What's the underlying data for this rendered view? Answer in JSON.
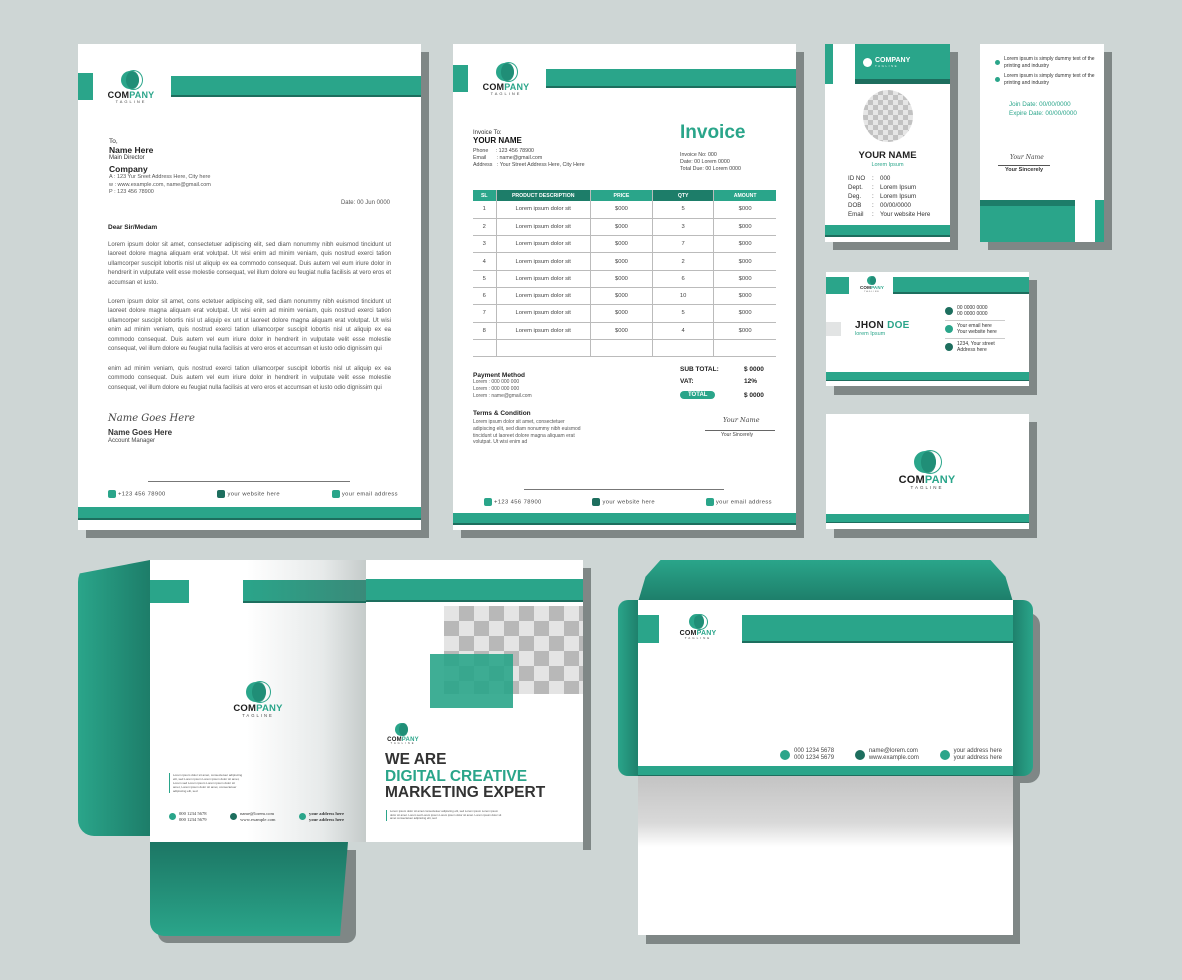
{
  "brand": {
    "word_a": "COM",
    "word_b": "PANY",
    "tagline": "TAGLINE",
    "accent": "#2aa58a",
    "accent_dark": "#1d7d69"
  },
  "letterhead": {
    "to": "To,",
    "name": "Name Here",
    "role": "Main Director",
    "company": "Company",
    "address": "A  : 123 Yur Sreet Address Here, City here",
    "web": "w  : www.example.com, name@gmail.com",
    "phone": "P  : 123 456 78900",
    "date": "Date: 00 Jun 0000",
    "greeting": "Dear Sir/Medam",
    "para1": "Lorem ipsum dolor sit amet, consectetuer adipiscing elit, sed diam nonummy nibh euismod tincidunt ut laoreet dolore magna aliquam erat volutpat. Ut wisi enim ad minim veniam, quis nostrud exerci tation ullamcorper suscipit lobortis nisl ut aliquip ex ea commodo consequat. Duis autem vel eum iriure dolor in hendrerit in vulputate velit esse molestie consequat, vel illum dolore eu feugiat nulla facilisis at vero eros et accumsan et iusto.",
    "para2": "Lorem ipsum dolor sit amet, cons ectetuer adipiscing elit, sed diam nonummy nibh euismod tincidunt ut laoreet dolore magna aliquam erat volutpat. Ut wisi enim ad minim veniam, quis nostrud exerci tation ullamcorper suscipit lobortis nisl ut aliquip ex unt ut laoreet dolore magna aliquam erat volutpat. Ut wisi enim ad minim veniam, quis nostrud exerci tation ullamcorper suscipit lobortis nisl ut aliquip ex ea commodo consequat. Duis autem vel eum iriure dolor in hendrerit in vulputate velit esse molestie consequat, vel illum dolore eu feugiat nulla facilisis at vero eros et accumsan et iusto odio dignissim qui",
    "para3": "enim ad minim veniam, quis nostrud exerci tation ullamcorper suscipit lobortis nisl ut aliquip ex ea commodo consequat. Duis autem vel eum iriure dolor in hendrerit in vulputate velit esse molestie consequat, vel illum dolore eu feugiat nulla facilisis at vero eros et accumsan et iusto odio dignissim qui",
    "signature": "Name Goes Here",
    "signer": "Name Goes Here",
    "signer_role": "Account Manager",
    "footer": {
      "phone": "+123 456 78900",
      "website": "your website here",
      "email": "your email address"
    }
  },
  "invoice": {
    "to_label": "Invoice To:",
    "to_name": "YOUR NAME",
    "phone": "Phone     : 123 456 78900",
    "email": "Email       : name@gmail.com",
    "address": "Address   : Your Street Address Here, City Here",
    "title": "Invoice",
    "number": "Invoice No: 000",
    "date": "Date: 00 Lorem 0000",
    "due": "Total Due: 00 Lorem 0000",
    "columns": [
      "SL",
      "PRODUCT DESCRIPTION",
      "PRICE",
      "QTY",
      "AMOUNT"
    ],
    "rows": [
      [
        "1",
        "Lorem ipsum dolor sit",
        "$000",
        "5",
        "$000"
      ],
      [
        "2",
        "Lorem ipsum dolor sit",
        "$000",
        "3",
        "$000"
      ],
      [
        "3",
        "Lorem ipsum dolor sit",
        "$000",
        "7",
        "$000"
      ],
      [
        "4",
        "Lorem ipsum dolor sit",
        "$000",
        "2",
        "$000"
      ],
      [
        "5",
        "Lorem ipsum dolor sit",
        "$000",
        "6",
        "$000"
      ],
      [
        "6",
        "Lorem ipsum dolor sit",
        "$000",
        "10",
        "$000"
      ],
      [
        "7",
        "Lorem ipsum dolor sit",
        "$000",
        "5",
        "$000"
      ],
      [
        "8",
        "Lorem ipsum dolor sit",
        "$000",
        "4",
        "$000"
      ],
      [
        "",
        "",
        "",
        "",
        ""
      ]
    ],
    "payment_title": "Payment Method",
    "payment_lines": [
      "Lorem  : 000 000 000",
      "Lorem  : 000 000 000",
      "Lorem  : name@gmail.com"
    ],
    "terms_title": "Terms & Condition",
    "terms_text": "Lorem ipsum dolor sit amet, consectetuer adipiscing elit, sed diam nonummy nibh euismod tincidunt ut laoreet dolore magna aliquam erat volutpat. Ut wisi enim ad",
    "subtotal_label": "SUB TOTAL:",
    "subtotal": "$ 0000",
    "vat_label": "VAT:",
    "vat": "12%",
    "total_label": "TOTAL",
    "total": "$ 0000",
    "signature": "Your Name",
    "sincerely": "Your Sincerely",
    "footer": {
      "phone": "+123 456 78900",
      "website": "your website here",
      "email": "your email address"
    }
  },
  "id_front": {
    "name": "YOUR NAME",
    "subtitle": "Lorem Ipsum",
    "fields": [
      {
        "k": "ID NO",
        "v": "000"
      },
      {
        "k": "Dept.",
        "v": "Lorem Ipsum"
      },
      {
        "k": "Deg.",
        "v": "Lorem Ipsum"
      },
      {
        "k": "DOB",
        "v": "00/00/0000"
      },
      {
        "k": "Email",
        "v": "Your website Here"
      }
    ]
  },
  "id_back": {
    "bullets": [
      "Lorem ipsum  is simply dummy text of the printing and industry",
      "Lorem ipsum  is simply dummy text of the printing and industry"
    ],
    "join": "Join Date: 00/00/0000",
    "expire": "Expire Date: 00/00/0000",
    "signature": "Your Name",
    "sincerely": "Your Sincerely"
  },
  "bizcard": {
    "first": "JHON",
    "last": "DOE",
    "subtitle": "lorem Ipsum",
    "phone1": "00 0000 0000",
    "phone2": "00 0000 0000",
    "email": "Your email here",
    "website": "Your website here",
    "addr1": "1234, Your street",
    "addr2": "Address here"
  },
  "folder": {
    "blurb": "Lorem ipsum dolor sit amet, consectetuer adipiscing elit, sed Lorem ipsum Lorem ipsum dolor sit amet, Lorem sed Lorem ipsum Lorem ipsum dolor sit amet, Lorem ipsum dolor sit amet, consectetuer adipiscing elit, sed",
    "phone1": "000 1234 5678",
    "phone2": "000 1234 5679",
    "email": "name@lorem.com",
    "website": "www.example.com",
    "addr1": "your address here",
    "addr2": "your address here",
    "headline1": "WE ARE",
    "headline2": "DIGITAL CREATIVE",
    "headline3": "MARKETING EXPERT",
    "cover_blurb": "Lorem ipsum dolor sit amet consectetuer adipiscing elit, sed Lorem ipsum Lorem ipsum dolor sit amet. Lorem sed Lorem ipsum Lorem ipsum dolor sit amet. Lorem ipsum dolor sit amet consectetuer adipiscing elit, sed"
  },
  "envelope": {
    "phone1": "000 1234 5678",
    "phone2": "000 1234 5679",
    "email": "name@lorem.com",
    "website": "www.example.com",
    "addr1": "your address here",
    "addr2": "your address here"
  }
}
